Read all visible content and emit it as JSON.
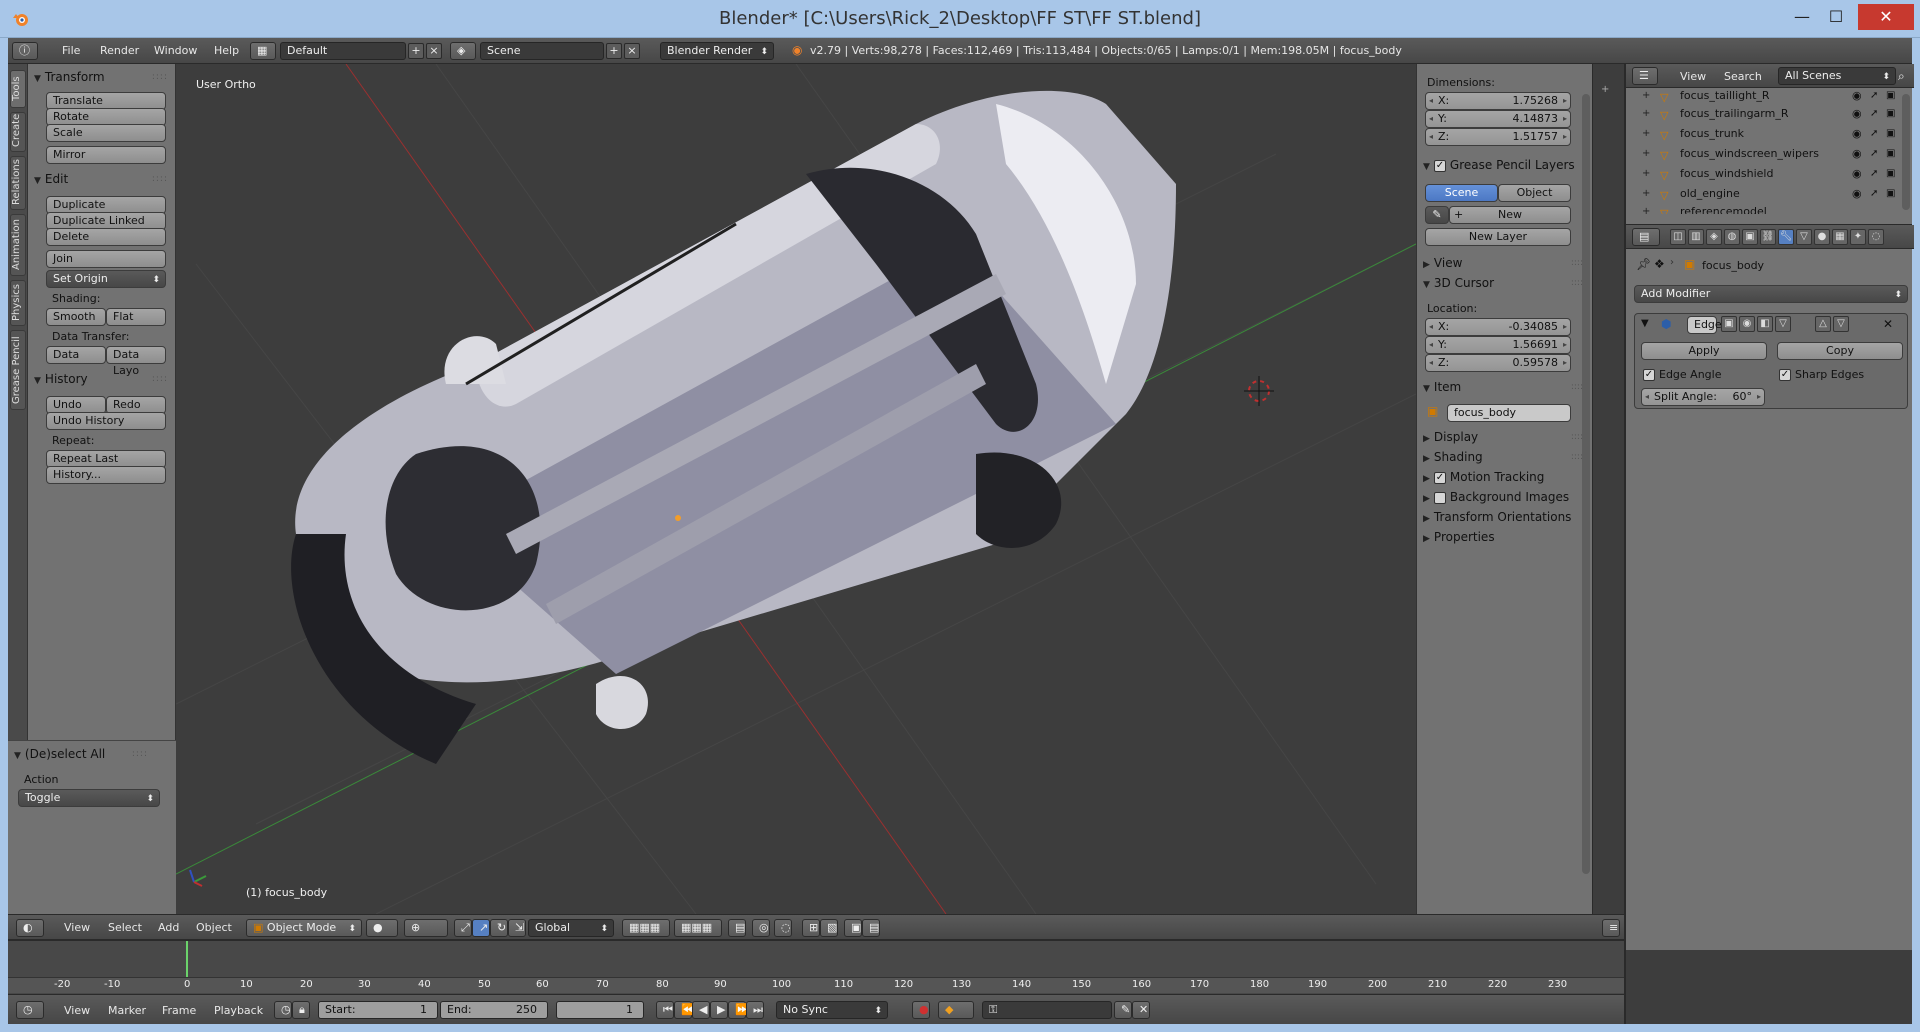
{
  "window": {
    "title": "Blender* [C:\\Users\\Rick_2\\Desktop\\FF ST\\FF ST.blend]",
    "min": "—",
    "max": "☐",
    "close": "✕"
  },
  "infobar": {
    "menus": [
      "File",
      "Render",
      "Window",
      "Help"
    ],
    "layout": "Default",
    "scene": "Scene",
    "engine": "Blender Render",
    "stats": "v2.79 | Verts:98,278 | Faces:112,469 | Tris:113,484 | Objects:0/65 | Lamps:0/1 | Mem:198.05M | focus_body"
  },
  "tool_tabs": [
    "Tools",
    "Create",
    "Relations",
    "Animation",
    "Physics",
    "Grease Pencil"
  ],
  "toolshelf": {
    "transform": {
      "title": "Transform",
      "translate": "Translate",
      "rotate": "Rotate",
      "scale": "Scale",
      "mirror": "Mirror"
    },
    "edit": {
      "title": "Edit",
      "duplicate": "Duplicate",
      "duplicate_linked": "Duplicate Linked",
      "delete": "Delete",
      "join": "Join",
      "set_origin": "Set Origin",
      "shading_label": "Shading:",
      "smooth": "Smooth",
      "flat": "Flat",
      "data_transfer_label": "Data Transfer:",
      "data": "Data",
      "data_layout": "Data Layo"
    },
    "history": {
      "title": "History",
      "undo": "Undo",
      "redo": "Redo",
      "undo_history": "Undo History",
      "repeat_label": "Repeat:",
      "repeat_last": "Repeat Last",
      "history": "History..."
    },
    "operator": {
      "title": "(De)select All",
      "action_label": "Action",
      "action_value": "Toggle"
    }
  },
  "viewport": {
    "view_label": "User Ortho",
    "object_label": "(1) focus_body"
  },
  "npanel": {
    "dimensions_label": "Dimensions:",
    "dim_x": "1.75268",
    "dim_y": "4.14873",
    "dim_z": "1.51757",
    "grease_pencil": "Grease Pencil Layers",
    "scene_tab": "Scene",
    "object_tab": "Object",
    "new": "New",
    "new_layer": "New Layer",
    "view": "View",
    "cursor": "3D Cursor",
    "location_label": "Location:",
    "loc_x": "-0.34085",
    "loc_y": "1.56691",
    "loc_z": "0.59578",
    "item": "Item",
    "item_name": "focus_body",
    "display": "Display",
    "shading": "Shading",
    "motion_tracking": "Motion Tracking",
    "background_images": "Background Images",
    "transform_orientations": "Transform Orientations",
    "properties": "Properties",
    "x": "X:",
    "y": "Y:",
    "z": "Z:"
  },
  "outliner": {
    "view": "View",
    "search": "Search",
    "scenes": "All Scenes",
    "items": [
      "focus_taillight_R",
      "focus_trailingarm_R",
      "focus_trunk",
      "focus_windscreen_wipers",
      "focus_windshield",
      "old_engine",
      "referencemodel"
    ]
  },
  "properties": {
    "object_name": "focus_body",
    "add_modifier": "Add Modifier",
    "mod_name": "Edge",
    "apply": "Apply",
    "copy": "Copy",
    "edge_angle": "Edge Angle",
    "sharp_edges": "Sharp Edges",
    "split_angle_label": "Split Angle:",
    "split_angle_value": "60°"
  },
  "vp_header": {
    "menus": [
      "View",
      "Select",
      "Add",
      "Object"
    ],
    "mode": "Object Mode",
    "orientation": "Global"
  },
  "timeline": {
    "ticks": [
      "-20",
      "-10",
      "0",
      "10",
      "20",
      "30",
      "40",
      "50",
      "60",
      "70",
      "80",
      "90",
      "100",
      "110",
      "120",
      "130",
      "140",
      "150",
      "160",
      "170",
      "180",
      "190",
      "200",
      "210",
      "220",
      "230"
    ],
    "menus": [
      "View",
      "Marker",
      "Frame",
      "Playback"
    ],
    "start": "Start:",
    "start_val": "1",
    "end": "End:",
    "end_val": "250",
    "current": "1",
    "sync": "No Sync"
  },
  "colors": {
    "accent": "#5680c2",
    "panel": "#727272",
    "viewport": "#3d3d3d"
  }
}
